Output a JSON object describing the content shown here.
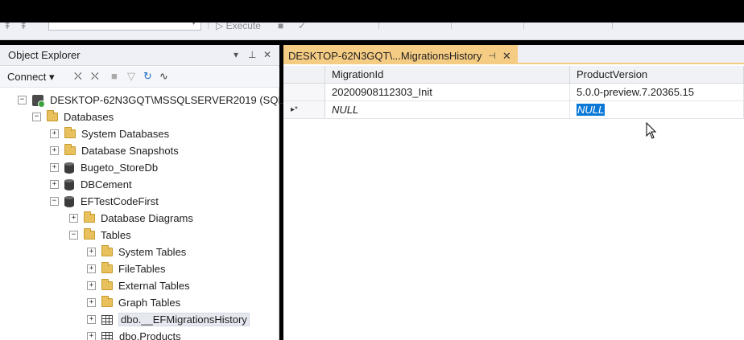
{
  "toolbar": {
    "execute_label": "Execute"
  },
  "object_explorer": {
    "title": "Object Explorer",
    "pin_glyph": "▾ ⊥ ✕",
    "connect_label": "Connect ▾",
    "server": "DESKTOP-62N3GQT\\MSSQLSERVER2019 (SQL",
    "databases_label": "Databases",
    "db_children": [
      "System Databases",
      "Database Snapshots",
      "Bugeto_StoreDb",
      "DBCement",
      "EFTestCodeFirst"
    ],
    "ef_children": [
      "Database Diagrams",
      "Tables"
    ],
    "table_children": [
      "System Tables",
      "FileTables",
      "External Tables",
      "Graph Tables",
      "dbo.__EFMigrationsHistory",
      "dbo.Products"
    ]
  },
  "document": {
    "tab_title": "DESKTOP-62N3GQT\\...MigrationsHistory",
    "tab_pin": "⊣",
    "tab_close": "✕",
    "columns": [
      "MigrationId",
      "ProductVersion"
    ],
    "rows": [
      {
        "marker": "",
        "MigrationId": "20200908112303_Init",
        "ProductVersion": "5.0.0-preview.7.20365.15"
      },
      {
        "marker": "▸*",
        "MigrationId": "NULL",
        "ProductVersion": "NULL"
      }
    ]
  }
}
